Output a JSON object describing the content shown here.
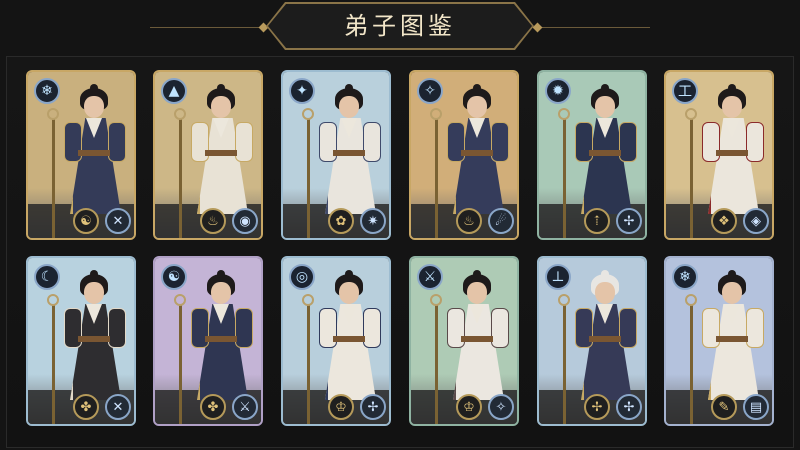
{
  "title": "弟子图鉴",
  "colors": {
    "accent_gold": "#b89a5c",
    "frame_dark": "#141414"
  },
  "cards": [
    {
      "card_bg": "#c9b07e",
      "border": "#c8a765",
      "robe": "#343b58",
      "trim": "#c7a964",
      "badge_icon": "❄",
      "skill_a": "☯",
      "skill_b": "✕",
      "hair": "dark"
    },
    {
      "card_bg": "#cdb787",
      "border": "#c8a765",
      "robe": "#e8e2d5",
      "trim": "#c7a964",
      "badge_icon": "▲",
      "skill_a": "♨",
      "skill_b": "◉",
      "hair": "dark"
    },
    {
      "card_bg": "#b9d0dc",
      "border": "#9dbcd0",
      "robe": "#e9e5dd",
      "trim": "#3f4a6b",
      "badge_icon": "✦",
      "skill_a": "✿",
      "skill_b": "✷",
      "hair": "dark"
    },
    {
      "card_bg": "#d1ae79",
      "border": "#c8a765",
      "robe": "#353c5b",
      "trim": "#c7a964",
      "badge_icon": "✧",
      "skill_a": "♨",
      "skill_b": "☄",
      "hair": "dark"
    },
    {
      "card_bg": "#a9c9b7",
      "border": "#8fb3a2",
      "robe": "#2c3550",
      "trim": "#c7a964",
      "badge_icon": "✹",
      "skill_a": "⇡",
      "skill_b": "✢",
      "hair": "dark"
    },
    {
      "card_bg": "#d7c08f",
      "border": "#c8a765",
      "robe": "#ebe6dc",
      "trim": "#8b2a2a",
      "badge_icon": "工",
      "skill_a": "❖",
      "skill_b": "◈",
      "hair": "dark"
    },
    {
      "card_bg": "#b8d2df",
      "border": "#9dbcd0",
      "robe": "#2e2d30",
      "trim": "#e2d9c8",
      "badge_icon": "☾",
      "skill_a": "✤",
      "skill_b": "✕",
      "hair": "dark"
    },
    {
      "card_bg": "#c4b4d6",
      "border": "#b0a0c6",
      "robe": "#2f3652",
      "trim": "#c7a964",
      "badge_icon": "☯",
      "skill_a": "✤",
      "skill_b": "⚔",
      "hair": "dark"
    },
    {
      "card_bg": "#b8cfdc",
      "border": "#9dbcd0",
      "robe": "#ece7dd",
      "trim": "#2f3a5c",
      "badge_icon": "◎",
      "skill_a": "♔",
      "skill_b": "✢",
      "hair": "dark"
    },
    {
      "card_bg": "#aecbb5",
      "border": "#8fb3a2",
      "robe": "#ebe7e0",
      "trim": "#5a4a4a",
      "badge_icon": "⚔",
      "skill_a": "♔",
      "skill_b": "✧",
      "hair": "dark"
    },
    {
      "card_bg": "#b6cadb",
      "border": "#9dbcd0",
      "robe": "#363a57",
      "trim": "#c7a964",
      "badge_icon": "⊥",
      "skill_a": "✢",
      "skill_b": "✢",
      "hair": "white"
    },
    {
      "card_bg": "#b4c2dd",
      "border": "#a4b2cf",
      "robe": "#ece7dd",
      "trim": "#c7a964",
      "badge_icon": "❄",
      "skill_a": "✎",
      "skill_b": "▤",
      "hair": "dark"
    }
  ]
}
